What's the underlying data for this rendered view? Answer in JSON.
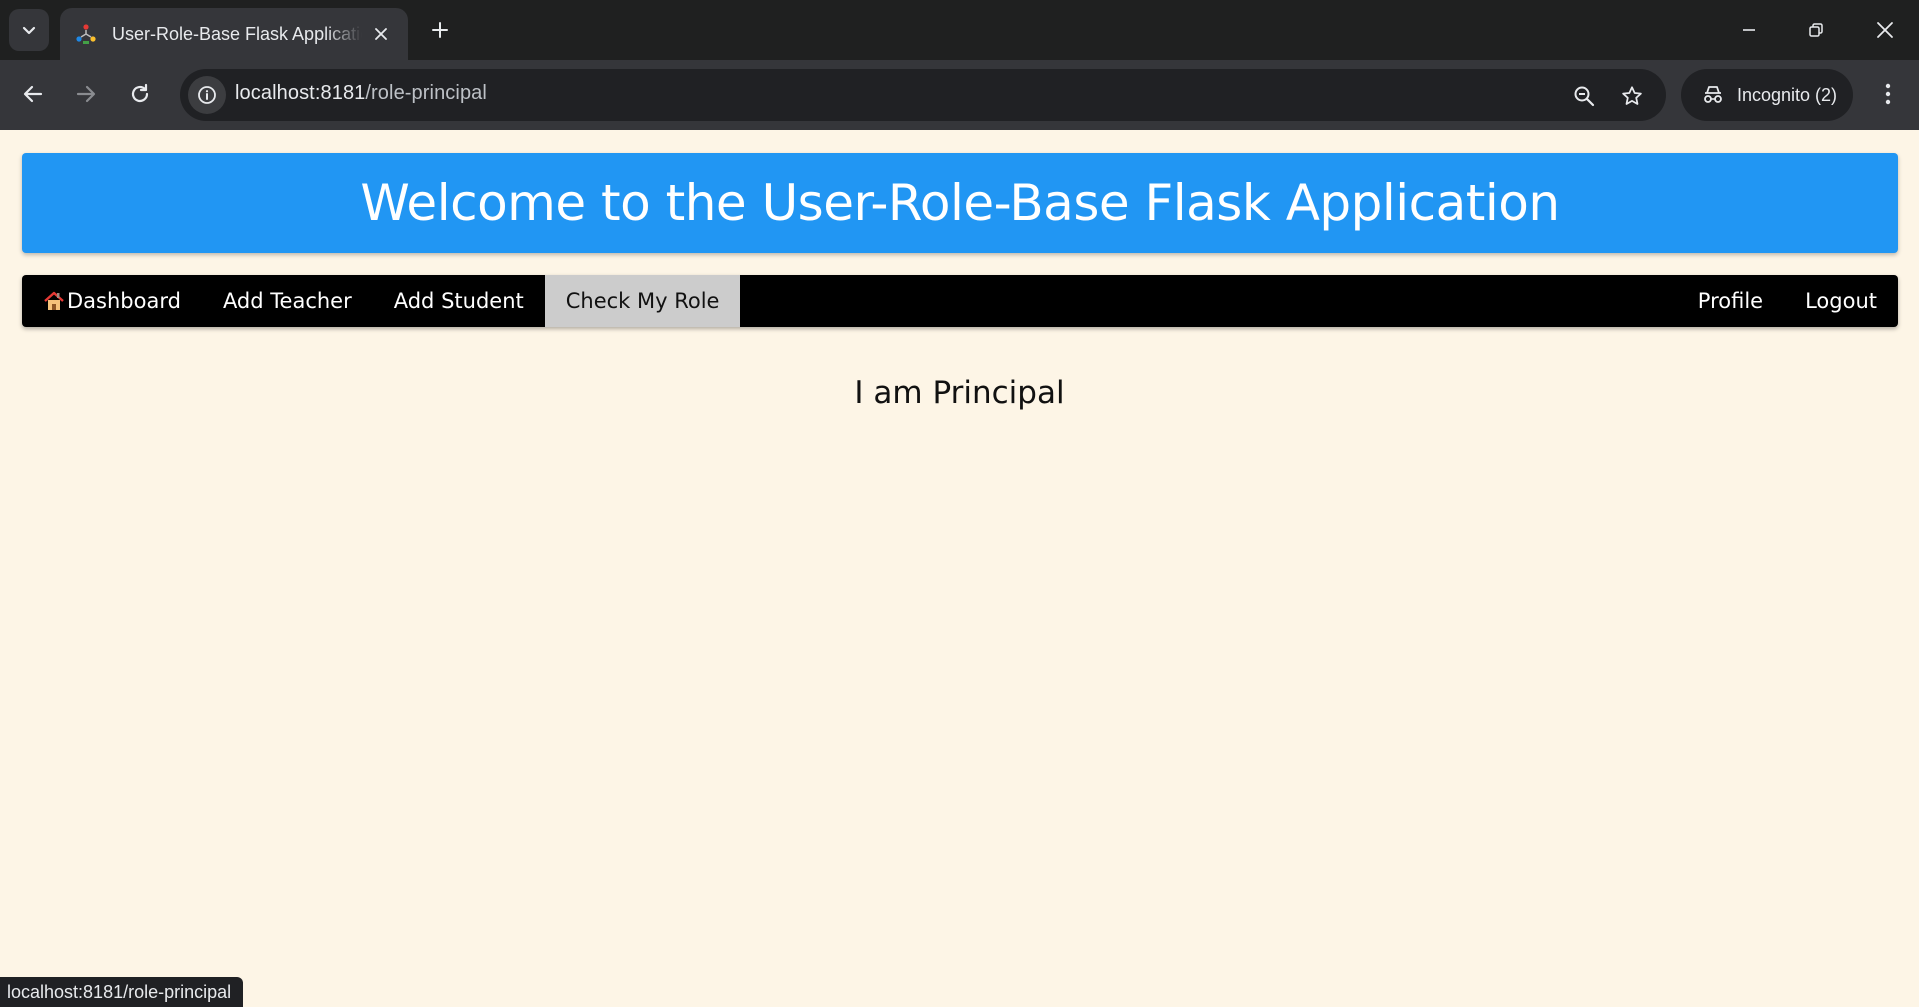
{
  "browser": {
    "tab_title": "User-Role-Base Flask Application",
    "url_host": "localhost:8181",
    "url_path": "/role-principal",
    "incognito_label": "Incognito (2)",
    "status_url": "localhost:8181/role-principal"
  },
  "header": {
    "title": "Welcome to the User-Role-Base Flask Application"
  },
  "nav": {
    "left": [
      {
        "label": "Dashboard",
        "icon": "house-icon"
      },
      {
        "label": "Add Teacher"
      },
      {
        "label": "Add Student"
      },
      {
        "label": "Check My Role",
        "active": true
      }
    ],
    "right": [
      {
        "label": "Profile"
      },
      {
        "label": "Logout"
      }
    ]
  },
  "main": {
    "role_message": "I am Principal"
  },
  "colors": {
    "banner": "#2196f3",
    "navbar": "#000000",
    "active_nav": "#cccccc",
    "page_bg": "#fdf5e6"
  }
}
